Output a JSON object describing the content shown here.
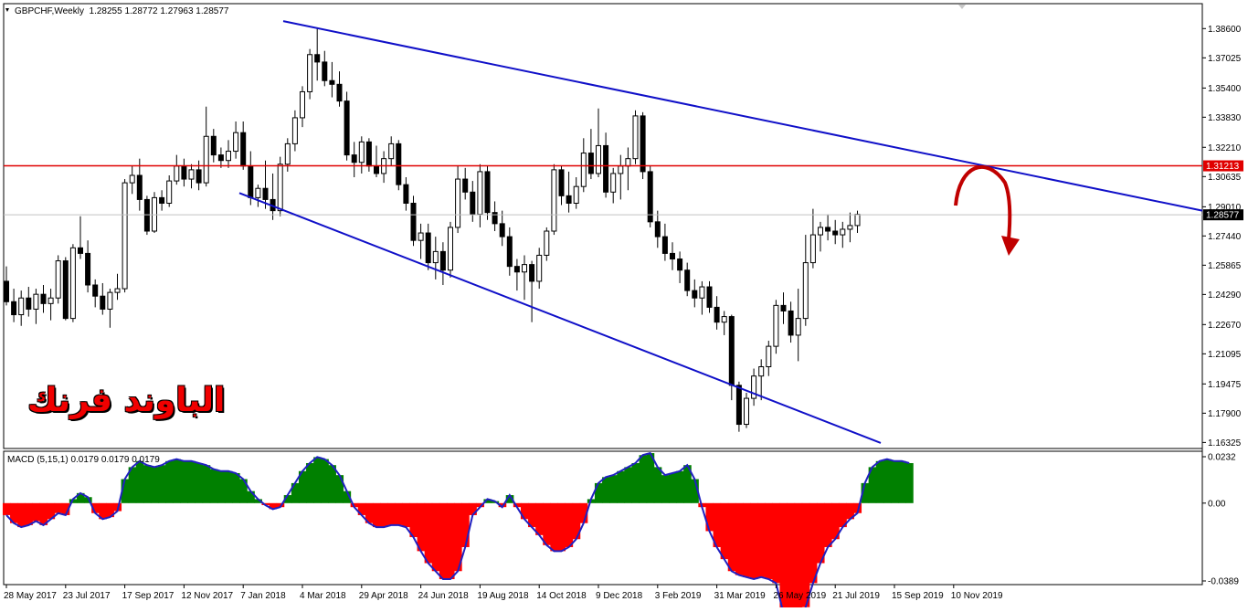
{
  "header": {
    "symbol": "GBPCHF,Weekly",
    "ohlc": "1.28255 1.28772 1.27963 1.28577",
    "macd_label": "MACD (5,15,1) 0.0179 0.0179 0.0179"
  },
  "watermark": "الباوند فرنك",
  "colors": {
    "bull": "#ffffff",
    "bear": "#000000",
    "trendline": "#1010c8",
    "resistance": "#e00000",
    "arrow": "#c00000",
    "macd_pos": "#008000",
    "macd_neg": "#ff0000",
    "macd_line": "#2020c0",
    "price_tag_red": "#e00000"
  },
  "chart_data": [
    {
      "type": "candlestick",
      "title": "GBPCHF,Weekly",
      "ylim": [
        1.16,
        1.3945
      ],
      "y_ticks": [
        "1.38600",
        "1.37025",
        "1.35400",
        "1.33830",
        "1.32210",
        "1.30635",
        "1.29010",
        "1.27440",
        "1.25865",
        "1.24290",
        "1.22670",
        "1.21095",
        "1.19475",
        "1.17900",
        "1.16325"
      ],
      "x_ticks": [
        "28 May 2017",
        "23 Jul 2017",
        "17 Sep 2017",
        "12 Nov 2017",
        "7 Jan 2018",
        "4 Mar 2018",
        "29 Apr 2018",
        "24 Jun 2018",
        "19 Aug 2018",
        "14 Oct 2018",
        "9 Dec 2018",
        "3 Feb 2019",
        "31 Mar 2019",
        "26 May 2019",
        "21 Jul 2019",
        "15 Sep 2019",
        "10 Nov 2019"
      ],
      "candles": [
        [
          1.25,
          1.258,
          1.237,
          1.239
        ],
        [
          1.239,
          1.246,
          1.228,
          1.232
        ],
        [
          1.232,
          1.245,
          1.226,
          1.241
        ],
        [
          1.241,
          1.247,
          1.231,
          1.235
        ],
        [
          1.235,
          1.246,
          1.227,
          1.243
        ],
        [
          1.243,
          1.248,
          1.233,
          1.238
        ],
        [
          1.238,
          1.246,
          1.229,
          1.241
        ],
        [
          1.241,
          1.264,
          1.238,
          1.261
        ],
        [
          1.261,
          1.263,
          1.229,
          1.23
        ],
        [
          1.23,
          1.27,
          1.228,
          1.268
        ],
        [
          1.268,
          1.285,
          1.262,
          1.265
        ],
        [
          1.265,
          1.272,
          1.244,
          1.248
        ],
        [
          1.248,
          1.251,
          1.236,
          1.242
        ],
        [
          1.242,
          1.249,
          1.232,
          1.235
        ],
        [
          1.235,
          1.246,
          1.225,
          1.244
        ],
        [
          1.244,
          1.254,
          1.24,
          1.246
        ],
        [
          1.246,
          1.305,
          1.244,
          1.303
        ],
        [
          1.303,
          1.312,
          1.297,
          1.307
        ],
        [
          1.307,
          1.316,
          1.288,
          1.294
        ],
        [
          1.294,
          1.296,
          1.275,
          1.277
        ],
        [
          1.277,
          1.298,
          1.276,
          1.295
        ],
        [
          1.295,
          1.299,
          1.288,
          1.292
        ],
        [
          1.292,
          1.307,
          1.29,
          1.304
        ],
        [
          1.304,
          1.318,
          1.302,
          1.312
        ],
        [
          1.312,
          1.316,
          1.301,
          1.305
        ],
        [
          1.305,
          1.313,
          1.3,
          1.31
        ],
        [
          1.31,
          1.315,
          1.299,
          1.303
        ],
        [
          1.303,
          1.344,
          1.301,
          1.328
        ],
        [
          1.328,
          1.332,
          1.314,
          1.318
        ],
        [
          1.318,
          1.322,
          1.311,
          1.315
        ],
        [
          1.315,
          1.326,
          1.311,
          1.32
        ],
        [
          1.32,
          1.336,
          1.316,
          1.33
        ],
        [
          1.33,
          1.336,
          1.31,
          1.312
        ],
        [
          1.312,
          1.32,
          1.291,
          1.295
        ],
        [
          1.295,
          1.302,
          1.29,
          1.3
        ],
        [
          1.3,
          1.315,
          1.289,
          1.294
        ],
        [
          1.294,
          1.308,
          1.283,
          1.288
        ],
        [
          1.288,
          1.317,
          1.285,
          1.313
        ],
        [
          1.313,
          1.327,
          1.309,
          1.324
        ],
        [
          1.324,
          1.342,
          1.32,
          1.338
        ],
        [
          1.338,
          1.355,
          1.333,
          1.352
        ],
        [
          1.352,
          1.375,
          1.348,
          1.372
        ],
        [
          1.372,
          1.386,
          1.358,
          1.368
        ],
        [
          1.368,
          1.374,
          1.355,
          1.358
        ],
        [
          1.358,
          1.368,
          1.349,
          1.356
        ],
        [
          1.356,
          1.363,
          1.344,
          1.347
        ],
        [
          1.347,
          1.352,
          1.315,
          1.318
        ],
        [
          1.318,
          1.325,
          1.306,
          1.314
        ],
        [
          1.314,
          1.328,
          1.308,
          1.325
        ],
        [
          1.325,
          1.327,
          1.309,
          1.312
        ],
        [
          1.312,
          1.323,
          1.306,
          1.308
        ],
        [
          1.308,
          1.32,
          1.303,
          1.316
        ],
        [
          1.316,
          1.328,
          1.312,
          1.324
        ],
        [
          1.324,
          1.326,
          1.299,
          1.302
        ],
        [
          1.302,
          1.306,
          1.288,
          1.292
        ],
        [
          1.292,
          1.296,
          1.269,
          1.272
        ],
        [
          1.272,
          1.281,
          1.262,
          1.276
        ],
        [
          1.276,
          1.281,
          1.256,
          1.26
        ],
        [
          1.26,
          1.274,
          1.251,
          1.266
        ],
        [
          1.266,
          1.271,
          1.248,
          1.256
        ],
        [
          1.256,
          1.282,
          1.252,
          1.279
        ],
        [
          1.279,
          1.312,
          1.276,
          1.305
        ],
        [
          1.305,
          1.311,
          1.294,
          1.298
        ],
        [
          1.298,
          1.304,
          1.282,
          1.286
        ],
        [
          1.286,
          1.313,
          1.279,
          1.309
        ],
        [
          1.309,
          1.312,
          1.283,
          1.287
        ],
        [
          1.287,
          1.293,
          1.277,
          1.281
        ],
        [
          1.281,
          1.288,
          1.269,
          1.274
        ],
        [
          1.274,
          1.279,
          1.253,
          1.258
        ],
        [
          1.258,
          1.262,
          1.245,
          1.255
        ],
        [
          1.255,
          1.264,
          1.24,
          1.259
        ],
        [
          1.259,
          1.261,
          1.228,
          1.25
        ],
        [
          1.25,
          1.268,
          1.246,
          1.264
        ],
        [
          1.264,
          1.279,
          1.261,
          1.277
        ],
        [
          1.277,
          1.313,
          1.275,
          1.31
        ],
        [
          1.31,
          1.312,
          1.291,
          1.296
        ],
        [
          1.296,
          1.309,
          1.287,
          1.292
        ],
        [
          1.292,
          1.306,
          1.289,
          1.301
        ],
        [
          1.301,
          1.327,
          1.298,
          1.319
        ],
        [
          1.319,
          1.332,
          1.305,
          1.308
        ],
        [
          1.308,
          1.343,
          1.306,
          1.323
        ],
        [
          1.323,
          1.33,
          1.295,
          1.298
        ],
        [
          1.298,
          1.311,
          1.292,
          1.308
        ],
        [
          1.308,
          1.318,
          1.294,
          1.312
        ],
        [
          1.312,
          1.322,
          1.299,
          1.316
        ],
        [
          1.316,
          1.342,
          1.313,
          1.339
        ],
        [
          1.339,
          1.341,
          1.305,
          1.309
        ],
        [
          1.309,
          1.312,
          1.279,
          1.282
        ],
        [
          1.282,
          1.288,
          1.268,
          1.274
        ],
        [
          1.274,
          1.281,
          1.261,
          1.265
        ],
        [
          1.265,
          1.271,
          1.256,
          1.262
        ],
        [
          1.262,
          1.266,
          1.249,
          1.256
        ],
        [
          1.256,
          1.26,
          1.242,
          1.245
        ],
        [
          1.245,
          1.251,
          1.236,
          1.241
        ],
        [
          1.241,
          1.25,
          1.232,
          1.247
        ],
        [
          1.247,
          1.25,
          1.233,
          1.236
        ],
        [
          1.236,
          1.242,
          1.224,
          1.228
        ],
        [
          1.228,
          1.234,
          1.221,
          1.231
        ],
        [
          1.231,
          1.232,
          1.186,
          1.194
        ],
        [
          1.194,
          1.196,
          1.169,
          1.173
        ],
        [
          1.173,
          1.19,
          1.171,
          1.187
        ],
        [
          1.187,
          1.203,
          1.183,
          1.199
        ],
        [
          1.199,
          1.208,
          1.186,
          1.204
        ],
        [
          1.204,
          1.218,
          1.199,
          1.215
        ],
        [
          1.215,
          1.24,
          1.211,
          1.237
        ],
        [
          1.237,
          1.244,
          1.227,
          1.234
        ],
        [
          1.234,
          1.239,
          1.217,
          1.221
        ],
        [
          1.221,
          1.246,
          1.207,
          1.23
        ],
        [
          1.23,
          1.275,
          1.226,
          1.26
        ],
        [
          1.26,
          1.289,
          1.257,
          1.275
        ],
        [
          1.275,
          1.282,
          1.266,
          1.279
        ],
        [
          1.279,
          1.286,
          1.272,
          1.277
        ],
        [
          1.277,
          1.283,
          1.27,
          1.275
        ],
        [
          1.275,
          1.282,
          1.268,
          1.278
        ],
        [
          1.278,
          1.287,
          1.271,
          1.28
        ],
        [
          1.28,
          1.288,
          1.276,
          1.286
        ]
      ],
      "current_price": 1.28577,
      "resistance_level": 1.31213,
      "resistance_label": "1.31213",
      "current_label": "1.28577",
      "upper_trendline": [
        [
          1.3945,
          1.288
        ]
      ],
      "lower_trendline": [
        [
          1.2975,
          1.163
        ]
      ],
      "forecast_arrow": "down"
    },
    {
      "type": "area",
      "title": "MACD (5,15,1) 0.0179 0.0179 0.0179",
      "ylim": [
        -0.0389,
        0.0232
      ],
      "y_ticks": [
        "0.0232",
        "0.00",
        "-0.0389"
      ],
      "values": [
        -0.006,
        -0.01,
        -0.012,
        -0.011,
        -0.009,
        -0.011,
        -0.008,
        -0.005,
        -0.006,
        0.002,
        0.005,
        0.003,
        -0.005,
        -0.008,
        -0.007,
        -0.004,
        0.012,
        0.018,
        0.021,
        0.019,
        0.018,
        0.019,
        0.021,
        0.022,
        0.021,
        0.021,
        0.02,
        0.019,
        0.017,
        0.016,
        0.016,
        0.015,
        0.012,
        0.006,
        0.002,
        -0.001,
        -0.003,
        -0.002,
        0.004,
        0.01,
        0.016,
        0.02,
        0.023,
        0.022,
        0.019,
        0.014,
        0.006,
        -0.002,
        -0.006,
        -0.01,
        -0.012,
        -0.012,
        -0.011,
        -0.011,
        -0.012,
        -0.017,
        -0.024,
        -0.03,
        -0.034,
        -0.038,
        -0.038,
        -0.034,
        -0.022,
        -0.006,
        -0.002,
        0.002,
        0.001,
        -0.002,
        0.004,
        -0.002,
        -0.008,
        -0.012,
        -0.016,
        -0.021,
        -0.024,
        -0.024,
        -0.022,
        -0.018,
        -0.01,
        0.002,
        0.01,
        0.013,
        0.014,
        0.016,
        0.018,
        0.02,
        0.024,
        0.025,
        0.018,
        0.014,
        0.015,
        0.016,
        0.019,
        0.012,
        -0.002,
        -0.014,
        -0.022,
        -0.028,
        -0.034,
        -0.036,
        -0.037,
        -0.038,
        -0.037,
        -0.038,
        -0.04,
        -0.055,
        -0.064,
        -0.061,
        -0.052,
        -0.04,
        -0.03,
        -0.022,
        -0.018,
        -0.012,
        -0.008,
        -0.005,
        0.01,
        0.018,
        0.021,
        0.022,
        0.021,
        0.021,
        0.02
      ]
    }
  ]
}
